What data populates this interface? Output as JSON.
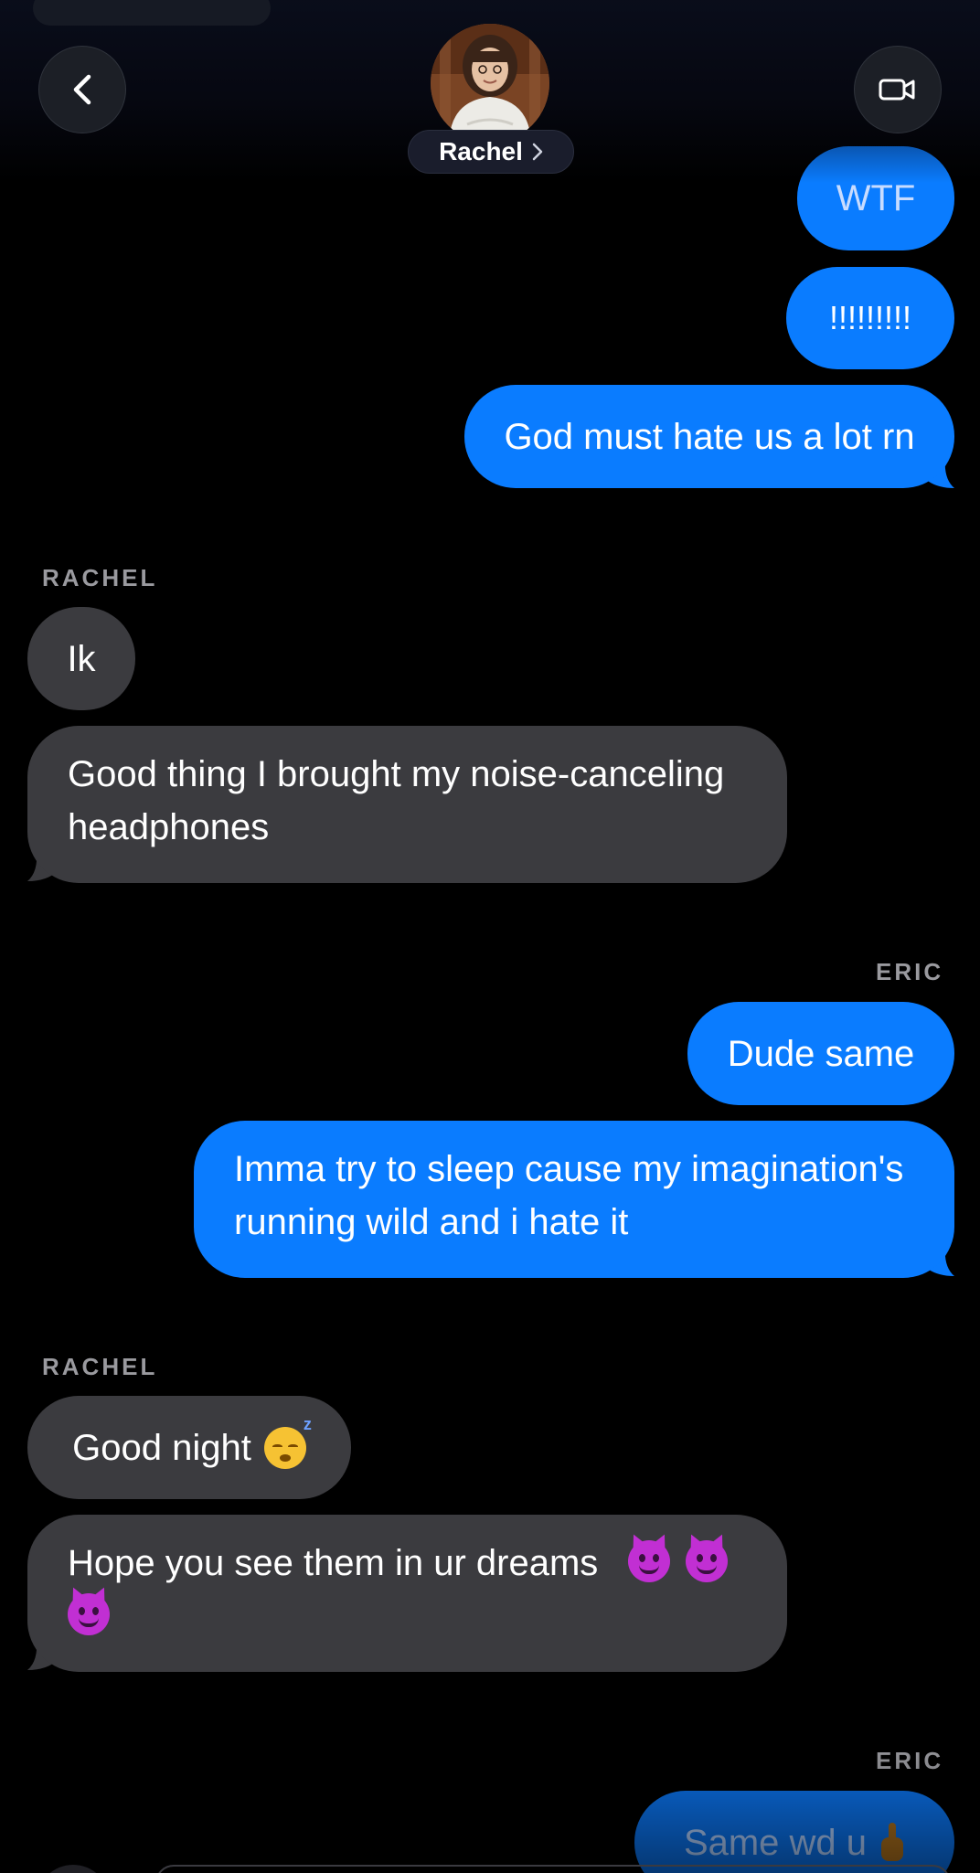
{
  "header": {
    "contact_name": "Rachel",
    "back_icon": "chevron-left-icon",
    "video_icon": "video-camera-icon",
    "name_chevron_icon": "chevron-right-icon"
  },
  "colors": {
    "outgoing_bubble": "#0a7cff",
    "incoming_bubble": "#3b3b3f",
    "background": "#000000",
    "sender_label": "#9a9a9f"
  },
  "messages": [
    {
      "id": "m1",
      "direction": "outgoing",
      "text": "WTF"
    },
    {
      "id": "m2",
      "direction": "outgoing",
      "text": "!!!!!!!!!"
    },
    {
      "id": "m3",
      "direction": "outgoing",
      "text": "God must hate us a lot rn"
    },
    {
      "id": "s1",
      "sender_label": "RACHEL"
    },
    {
      "id": "m4",
      "direction": "incoming",
      "text": "Ik"
    },
    {
      "id": "m5",
      "direction": "incoming",
      "line1": "Good thing I brought my noise-canceling",
      "line2": "headphones"
    },
    {
      "id": "s2",
      "sender_label": "ERIC"
    },
    {
      "id": "m6",
      "direction": "outgoing",
      "text": "Dude same"
    },
    {
      "id": "m7",
      "direction": "outgoing",
      "line1": "Imma try to sleep cause my imagination's",
      "line2": "running wild and i hate it"
    },
    {
      "id": "s3",
      "sender_label": "RACHEL"
    },
    {
      "id": "m8",
      "direction": "incoming",
      "text": "Good night",
      "emoji": "sleeping-face-emoji"
    },
    {
      "id": "m9",
      "direction": "incoming",
      "text": "Hope you see them in ur dreams",
      "emoji": "smiling-devil-emoji"
    },
    {
      "id": "s4",
      "sender_label": "ERIC"
    },
    {
      "id": "m10",
      "direction": "outgoing",
      "text": "Same wd u",
      "emoji": "middle-finger-emoji"
    }
  ]
}
